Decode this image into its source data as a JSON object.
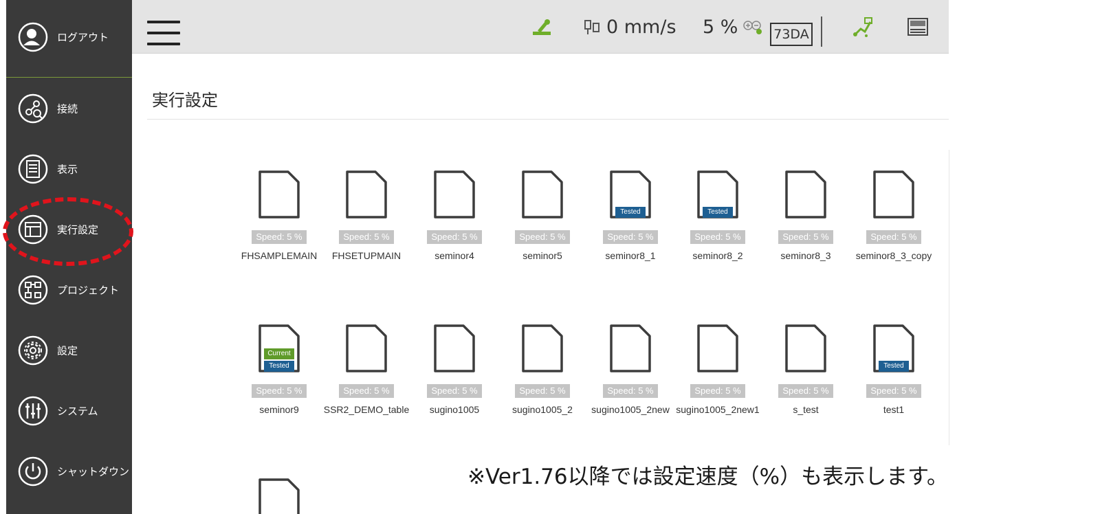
{
  "sidebar": {
    "items": [
      {
        "label": "ログアウト",
        "icon": "logout-user-icon"
      },
      {
        "label": "接続",
        "icon": "connection-icon"
      },
      {
        "label": "表示",
        "icon": "display-icon"
      },
      {
        "label": "実行設定",
        "icon": "run-settings-icon"
      },
      {
        "label": "プロジェクト",
        "icon": "project-icon"
      },
      {
        "label": "設定",
        "icon": "gear-icon"
      },
      {
        "label": "システム",
        "icon": "sliders-icon"
      },
      {
        "label": "シャットダウン",
        "icon": "power-icon"
      }
    ]
  },
  "header": {
    "speed": "0 mm/s",
    "percent": "5 %",
    "mode": "73DA"
  },
  "page": {
    "title": "実行設定"
  },
  "badges": {
    "tested": "Tested",
    "current": "Current"
  },
  "files": [
    {
      "name": "FHSAMPLEMAIN",
      "speed": "Speed: 5 %",
      "tested": false,
      "current": false
    },
    {
      "name": "FHSETUPMAIN",
      "speed": "Speed: 5 %",
      "tested": false,
      "current": false
    },
    {
      "name": "seminor4",
      "speed": "Speed: 5 %",
      "tested": false,
      "current": false
    },
    {
      "name": "seminor5",
      "speed": "Speed: 5 %",
      "tested": false,
      "current": false
    },
    {
      "name": "seminor8_1",
      "speed": "Speed: 5 %",
      "tested": true,
      "current": false
    },
    {
      "name": "seminor8_2",
      "speed": "Speed: 5 %",
      "tested": true,
      "current": false
    },
    {
      "name": "seminor8_3",
      "speed": "Speed: 5 %",
      "tested": false,
      "current": false
    },
    {
      "name": "seminor8_3_copy",
      "speed": "Speed: 5 %",
      "tested": false,
      "current": false
    },
    {
      "name": "seminor9",
      "speed": "Speed: 5 %",
      "tested": true,
      "current": true
    },
    {
      "name": "SSR2_DEMO_table",
      "speed": "Speed: 5 %",
      "tested": false,
      "current": false
    },
    {
      "name": "sugino1005",
      "speed": "Speed: 5 %",
      "tested": false,
      "current": false
    },
    {
      "name": "sugino1005_2",
      "speed": "Speed: 5 %",
      "tested": false,
      "current": false
    },
    {
      "name": "sugino1005_2new",
      "speed": "Speed: 5 %",
      "tested": false,
      "current": false
    },
    {
      "name": "sugino1005_2new1",
      "speed": "Speed: 5 %",
      "tested": false,
      "current": false
    },
    {
      "name": "s_test",
      "speed": "Speed: 5 %",
      "tested": false,
      "current": false
    },
    {
      "name": "test1",
      "speed": "Speed: 5 %",
      "tested": true,
      "current": false
    },
    {
      "name": "",
      "speed": "",
      "tested": false,
      "current": false
    }
  ],
  "note": "※Ver1.76以降では設定速度（%）も表示します。",
  "colors": {
    "sidebar_bg": "#3a3a3a",
    "header_bg": "#e4e4e4",
    "accent_green": "#6fae2a",
    "tested_blue": "#1e5f92",
    "current_green": "#5f9b2a",
    "highlight_red": "#e0141c"
  }
}
